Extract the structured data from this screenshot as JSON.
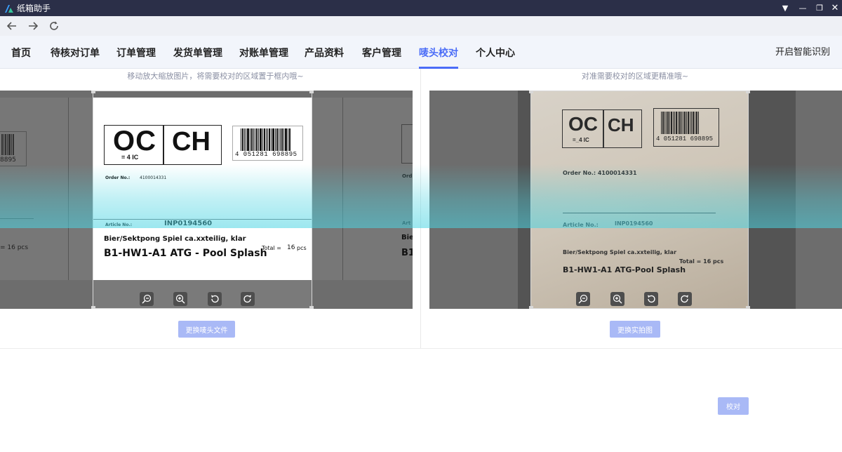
{
  "app": {
    "title": "纸箱助手"
  },
  "menu": {
    "items": [
      {
        "label": "首页"
      },
      {
        "label": "待核对订单"
      },
      {
        "label": "订单管理"
      },
      {
        "label": "发货单管理"
      },
      {
        "label": "对账单管理"
      },
      {
        "label": "产品资料"
      },
      {
        "label": "客户管理"
      },
      {
        "label": "唛头校对",
        "active": true
      },
      {
        "label": "个人中心"
      }
    ],
    "right_action": "开启智能识别"
  },
  "left_panel": {
    "hint": "移动放大缩放图片，将需要校对的区域置于框内哦~",
    "button": "更换唛头文件",
    "label": {
      "box1": "OC",
      "box1_sub": "=   4  IC",
      "box2": "CH",
      "barcode_number": "4 051281 698895",
      "order_label": "Order No.:",
      "order_value": "4100014331",
      "article_label": "Article No.:",
      "article_value": "INP0194560",
      "product_line": "Bier/Sektpong Spiel ca.xxteilig, klar",
      "product_code": "B1-HW1-A1 ATG - Pool Splash",
      "total_label": "Total =",
      "total_value": "16",
      "total_unit": "pcs",
      "ghost_barcode": "8895",
      "ghost_total": "=    16  pcs",
      "ghost_order": "Ord",
      "ghost_article": "Art",
      "ghost_bier": "Bie",
      "ghost_b1": "B1"
    }
  },
  "right_panel": {
    "hint": "对准需要校对的区域更精准哦~",
    "button": "更换实拍图",
    "photo": {
      "box1": "OC",
      "box1_sub": "=_4 IC",
      "box2": "CH",
      "barcode_number": "4 051281 698895",
      "order_text": "Order No.: 4100014331",
      "article_label": "Article No.:",
      "article_value": "INP0194560",
      "product_line": "Bier/Sektpong Spiel ca.xxteilig, klar",
      "product_code": "B1-HW1-A1 ATG-Pool Splash",
      "total_text": "Total = 16 pcs"
    }
  },
  "actions": {
    "verify": "校对"
  },
  "icons": [
    "zoom-out-icon",
    "zoom-in-icon",
    "rotate-left-icon",
    "rotate-right-icon"
  ],
  "colors": {
    "accent": "#4a6cf7",
    "titlebar": "#2b2f48",
    "button_disabled": "#a9b9f6"
  }
}
